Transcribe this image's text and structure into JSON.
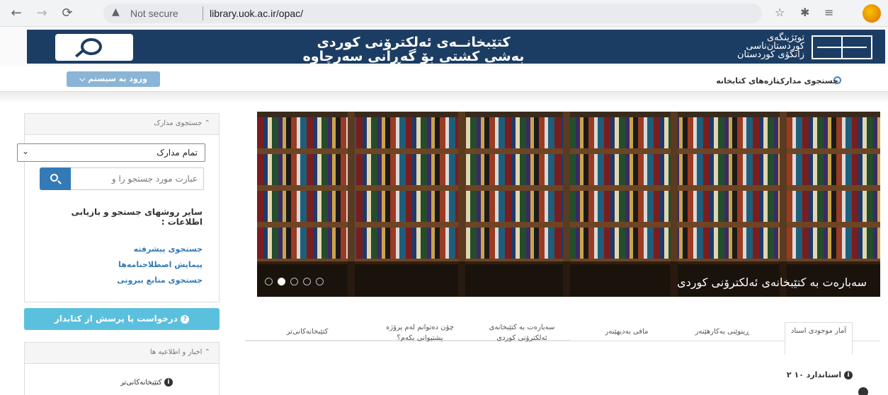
{
  "browser": {
    "security_label": "Not secure",
    "url": "library.uok.ac.ir/opac/"
  },
  "banner": {
    "title_line1": "كتێبخانــەی ئەلكترۆنی كوردی",
    "title_line2": "بەشی كشتی بۆ گەڕانی سەرچاوە",
    "uni_line1": "توێژینگەی",
    "uni_line2": "كوردستان‌ناسی",
    "uni_line3": "زانكۆی كوردستان"
  },
  "topnav": {
    "login_label": "ورود به سیستم",
    "search_docs": "جستجوی مدارک",
    "new_items": "تازه‌های کتابخانه"
  },
  "search_panel": {
    "header": "جستجوی مدارک",
    "select_value": "تمام مدارک",
    "input_placeholder": "عبارت مورد جستجو را و",
    "other_methods": "سایر روشهای جستجو و بازیابی اطلاعات :",
    "links": [
      "جستجوی پیشرفته",
      "پیمایش اصطلاحنامه‌ها",
      "جستجوی منابع بیرونی"
    ]
  },
  "ask_button": "درخواست یا پرسش از کتابدار",
  "news_panel": {
    "header": "اخبار و اطلاعیه ها",
    "item": "كتێبخانەكانی‌تر"
  },
  "carousel": {
    "caption": "سەبارەت بە كتێبخانەی ئەلكترۆنی كوردی",
    "slide_count": 5,
    "active_slide": 2
  },
  "tabs": [
    "آمار موجودی اسناد",
    "ڕینوێنی بەكارهێنەر",
    "مافی بەدیهێنەر",
    "سەبارەت بە كتێبخانەی ئەلكترۆنی كوردی",
    "چۆن دەتوانم لەم پرۆژە پشتیوانی بكەم؟",
    "كتێبخانەكانی‌تر"
  ],
  "stats": {
    "documents_label": "استاندارد ۱۰ ۲"
  },
  "colors": {
    "banner": "#1c3d63",
    "primary": "#337ab7",
    "info": "#5bc0de"
  }
}
